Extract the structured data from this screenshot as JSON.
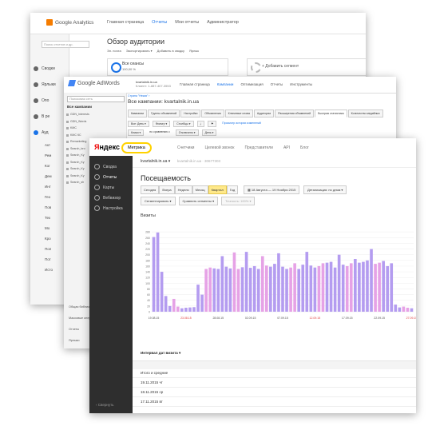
{
  "ga": {
    "logo": "Google Analytics",
    "nav": [
      "Главная страница",
      "Отчеты",
      "Мои отчеты",
      "Администратор"
    ],
    "nav_active": 1,
    "search_placeholder": "Поиск отчетов и др.",
    "side_items": [
      "Сводки",
      "Ярлыки",
      "Опо",
      "В ре",
      "Ауд"
    ],
    "side_sub": [
      "Акт",
      "Рем",
      "Ког",
      "Дем",
      "Инт",
      "Гео",
      "Пов",
      "Тех",
      "Мо",
      "Кро",
      "Пол",
      "Пот",
      "Исто"
    ],
    "title": "Обзор аудитории",
    "tools": [
      "Эл. почта",
      "Экспортировать ▾",
      "Добавить в сводку",
      "Ярлык"
    ],
    "segment_all": "Все сеансы",
    "segment_pct": "100,00 %",
    "segment_add": "+ Добавить сегмент"
  },
  "aw": {
    "logo": "Google AdWords",
    "account_name": "kvartalnik.in.ua",
    "account_id": "Клиент: 1-887-407-3553",
    "nav": [
      "Главная страница",
      "Кампании",
      "Оптимизация",
      "Отчеты",
      "Инструменты"
    ],
    "nav_active": 1,
    "search_placeholder": "Поисковая сеть",
    "side_header": "Все кампании",
    "campaigns": [
      "GDN_Interests",
      "GDN_Words",
      "KMC",
      "KMC КС",
      "Remarketing",
      "Search_bro",
      "Search_Ky",
      "Search_Ky",
      "Search_Ky",
      "Search_Ky",
      "Search_sh"
    ],
    "side_links": [
      "Общая библиотека",
      "Массовые операции",
      "Отчеты",
      "Ярлыки"
    ],
    "breadcrumb": "Страна \"Некая\" ›",
    "title": "Все кампании: kvartalnik.in.ua",
    "tabs": [
      "Кампании",
      "Группы объявлений",
      "Настройки",
      "Объявления",
      "Ключевые слова",
      "Аудитории",
      "Расширения объявлений",
      "Быстрая статистика",
      "Количество медийных"
    ],
    "tabs_active": 7,
    "controls": [
      "Все: День ▾",
      "Фильтр ▾",
      "Столбцы ▾",
      "⤓",
      "⚑",
      "Просмотр истории изменений"
    ],
    "controls2": [
      "Клики ▾",
      "по сравнению с",
      "Отключено ▾",
      "День ▾"
    ]
  },
  "ym": {
    "logo_y": "Я",
    "logo_rest": "ндекс",
    "metrika": "Метрика",
    "top_nav": [
      "Счетчики",
      "Целевой звонок",
      "Представители",
      "API",
      "Блог"
    ],
    "site": "kvartalnik.in.ua ▾",
    "site_sub": "kvartalnik.in.ua · 30677303",
    "side": [
      "Сводка",
      "Отчеты",
      "Карты",
      "Вебвизор",
      "Настройка"
    ],
    "side_active": 1,
    "side_bottom": "‹ Свернуть",
    "page_title": "Посещаемость",
    "ranges": [
      "Сегодня",
      "Вчера",
      "Неделя",
      "Месяц",
      "Квартал",
      "Год"
    ],
    "range_active": 4,
    "dates": "18 Августа — 19 Ноября 2015",
    "detail": "Детализация: по дням ▾",
    "segment_btns": [
      "Сегментировать ▾",
      "Сравнить сегменты ▾",
      "Точность: 100% ▾"
    ],
    "visits_label": "Визиты",
    "interval": "Интервал дат визита ▾",
    "table_rows": [
      "Итого и средние",
      "19.11.2015 чт",
      "18.11.2015 ср",
      "17.11.2015 вт"
    ]
  },
  "chart_data": {
    "type": "bar",
    "title": "Визиты",
    "ylim": [
      0,
      300
    ],
    "yticks": [
      0,
      20,
      40,
      60,
      80,
      100,
      120,
      140,
      160,
      180,
      200,
      220,
      240,
      260,
      280
    ],
    "xtick_labels": [
      "19.08.15",
      "23.08.15",
      "28.08.15",
      "02.09.15",
      "07.09.15",
      "12.09.15",
      "17.09.15",
      "22.09.15",
      "27.09.15"
    ],
    "values": [
      262,
      278,
      140,
      55,
      20,
      45,
      18,
      12,
      14,
      15,
      16,
      95,
      60,
      150,
      155,
      152,
      150,
      195,
      158,
      152,
      208,
      150,
      156,
      210,
      154,
      160,
      150,
      195,
      162,
      158,
      168,
      205,
      158,
      150,
      155,
      170,
      150,
      165,
      210,
      162,
      155,
      160,
      170,
      172,
      175,
      155,
      200,
      165,
      160,
      170,
      185,
      172,
      175,
      180,
      220,
      168,
      172,
      178,
      160,
      170,
      25,
      15,
      18,
      14,
      12
    ],
    "highlight_color": "#e6a2e6",
    "base_color": "#b49cf0",
    "highlighted": [
      5,
      6,
      13,
      14,
      20,
      21,
      27,
      28,
      34,
      35,
      41,
      42,
      48,
      49,
      55,
      56,
      62,
      63
    ]
  }
}
